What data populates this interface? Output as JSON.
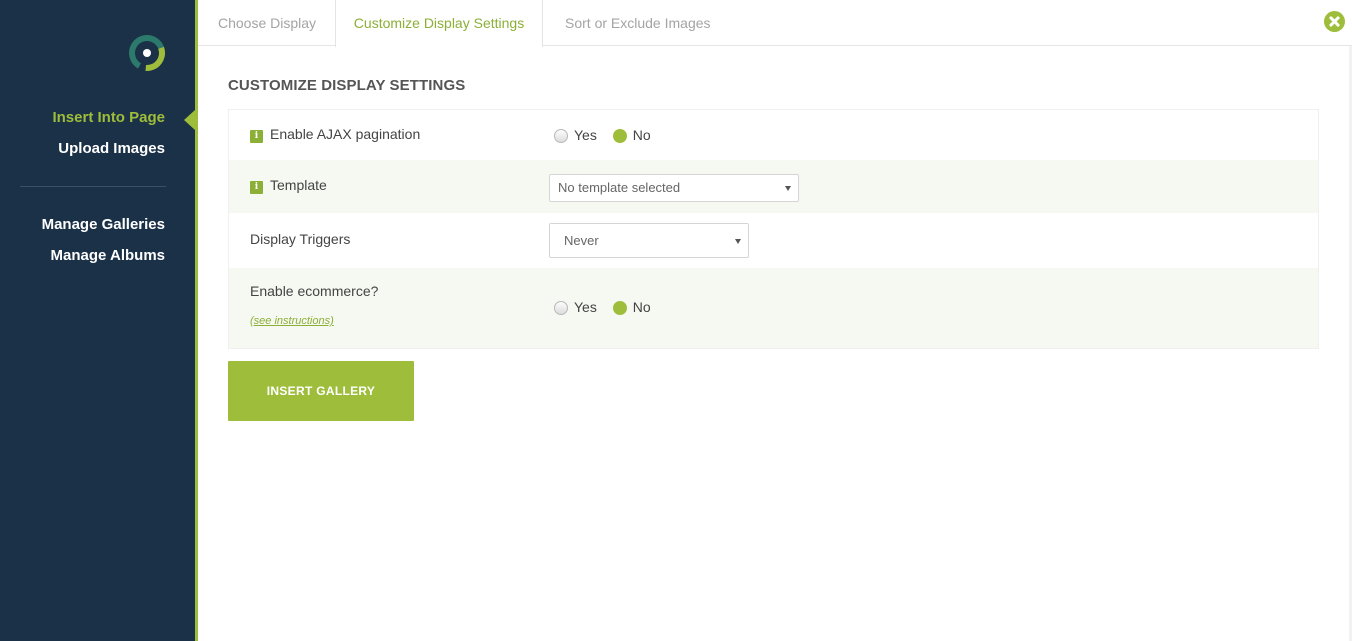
{
  "sidebar": {
    "items": [
      {
        "label": "Insert Into Page",
        "active": true
      },
      {
        "label": "Upload Images"
      },
      {
        "label": "Manage Galleries"
      },
      {
        "label": "Manage Albums"
      }
    ]
  },
  "tabs": [
    {
      "label": "Choose Display"
    },
    {
      "label": "Customize Display Settings",
      "active": true
    },
    {
      "label": "Sort or Exclude Images"
    }
  ],
  "section_title": "CUSTOMIZE DISPLAY SETTINGS",
  "settings": {
    "ajax": {
      "label": "Enable AJAX pagination",
      "yes": "Yes",
      "no": "No",
      "selected": "No"
    },
    "template": {
      "label": "Template",
      "value": "No template selected"
    },
    "triggers": {
      "label": "Display Triggers",
      "value": "Never"
    },
    "ecommerce": {
      "label": "Enable ecommerce?",
      "link": "(see instructions)",
      "yes": "Yes",
      "no": "No",
      "selected": "No"
    }
  },
  "insert_button": "INSERT GALLERY",
  "colors": {
    "accent": "#9ebd3b",
    "sidebar": "#1b3148"
  },
  "icons": {
    "close": "close-icon",
    "info": "info-icon",
    "logo": "logo-icon"
  }
}
